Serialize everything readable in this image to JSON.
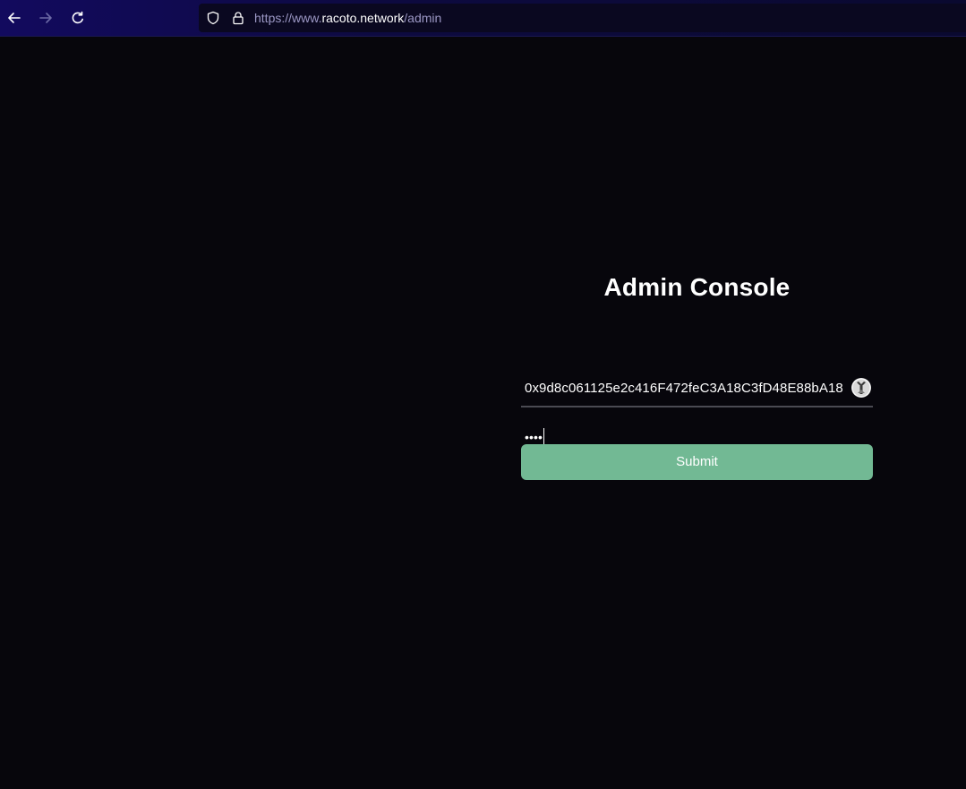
{
  "browser": {
    "back_icon": "arrow-left-icon",
    "forward_icon": "arrow-right-icon",
    "reload_icon": "reload-icon",
    "shield_icon": "shield-icon",
    "lock_icon": "lock-icon",
    "url": {
      "scheme": "https://www.",
      "host": "racoto.network",
      "path": "/admin"
    }
  },
  "login": {
    "title": "Admin Console",
    "address_value": "0x9d8c061125e2c416F472feC3A18C3fD48E88bA18",
    "address_icon": "wallet-avatar-icon",
    "password_masked": "••••",
    "submit_label": "Submit"
  },
  "colors": {
    "background": "#07060c",
    "toolbar": "#120a5e",
    "accent": "#72b994"
  }
}
